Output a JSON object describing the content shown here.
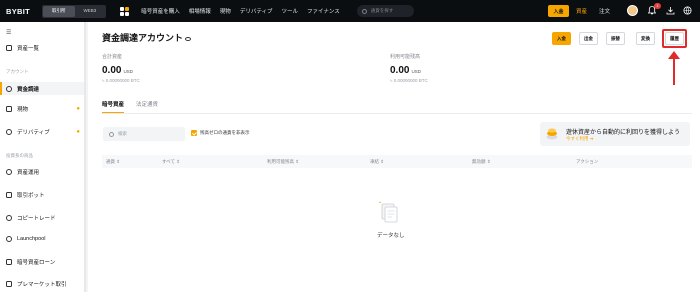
{
  "topbar": {
    "logo": "BYBIT",
    "modes": [
      "取引所",
      "WEB3"
    ],
    "nav": [
      "暗号資産を購入",
      "相場情報",
      "現物",
      "デリバティブ",
      "ツール",
      "ファイナンス"
    ],
    "search_placeholder": "通貨を探す",
    "deposit_label": "入金",
    "assets_label": "資産",
    "orders_label": "注文",
    "notification_count": "1",
    "accent_color": "#f7a600"
  },
  "sidebar": {
    "overview": "資産一覧",
    "category_account": "アカウント",
    "funding": "資金調達",
    "spot": "現物",
    "derivatives": "デリバティブ",
    "category_products": "投資系の商品",
    "earn": "資産運用",
    "bot": "取引ボット",
    "copytrade": "コピートレード",
    "launchpool": "Launchpool",
    "loan": "暗号資産ローン",
    "premarket": "プレマーケット取引"
  },
  "page": {
    "title": "資金調達アカウント",
    "buttons": [
      "入金",
      "出金",
      "振替",
      "変換",
      "履歴"
    ],
    "total_label": "合計資産",
    "total_value": "0.00",
    "total_unit": "USD",
    "total_btc": "≈ 0.00000000 BTC",
    "available_label": "利用可能残高",
    "available_value": "0.00",
    "available_unit": "USD",
    "available_btc": "≈ 0.00000000 BTC",
    "tabs": [
      "暗号資産",
      "法定通貨"
    ],
    "coin_search_placeholder": "検索",
    "hide_zero_label": "残高ゼロの通貨を非表示",
    "promo_title": "遊休資産から自動的に利回りを獲得しよう",
    "promo_link": "今すぐ利用 ➜",
    "table_headers": [
      "通貨 ⇕",
      "すべて ⇕",
      "利用可能残高 ⇕",
      "凍結 ⇕",
      "無効額 ⇕",
      "アクション"
    ],
    "empty_text": "データなし"
  }
}
